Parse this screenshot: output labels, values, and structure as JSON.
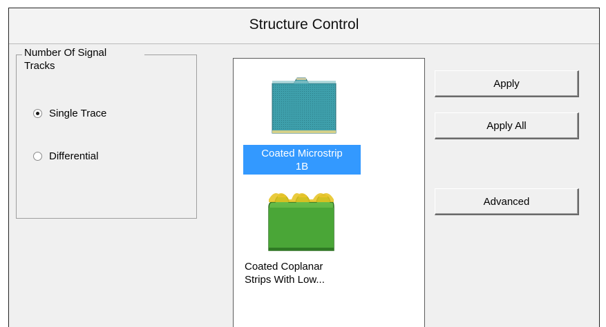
{
  "window": {
    "title": "Structure Control"
  },
  "group": {
    "legend_line1": "Number Of Signal",
    "legend_line2": "Tracks",
    "options": [
      {
        "label": "Single Trace",
        "checked": true
      },
      {
        "label": "Differential",
        "checked": false
      }
    ]
  },
  "structures": [
    {
      "line1": "Coated Microstrip",
      "line2": "1B",
      "selected": true,
      "icon": "coated-microstrip-icon"
    },
    {
      "line1": "Coated Coplanar",
      "line2": "Strips With Low...",
      "selected": false,
      "icon": "coated-coplanar-strips-icon"
    }
  ],
  "buttons": {
    "apply": "Apply",
    "apply_all": "Apply All",
    "advanced": "Advanced"
  },
  "colors": {
    "selection": "#3399ff",
    "microstrip_fill": "#3a9aa6",
    "coplanar_fill": "#4fa83a",
    "conductor": "#e8c020"
  }
}
